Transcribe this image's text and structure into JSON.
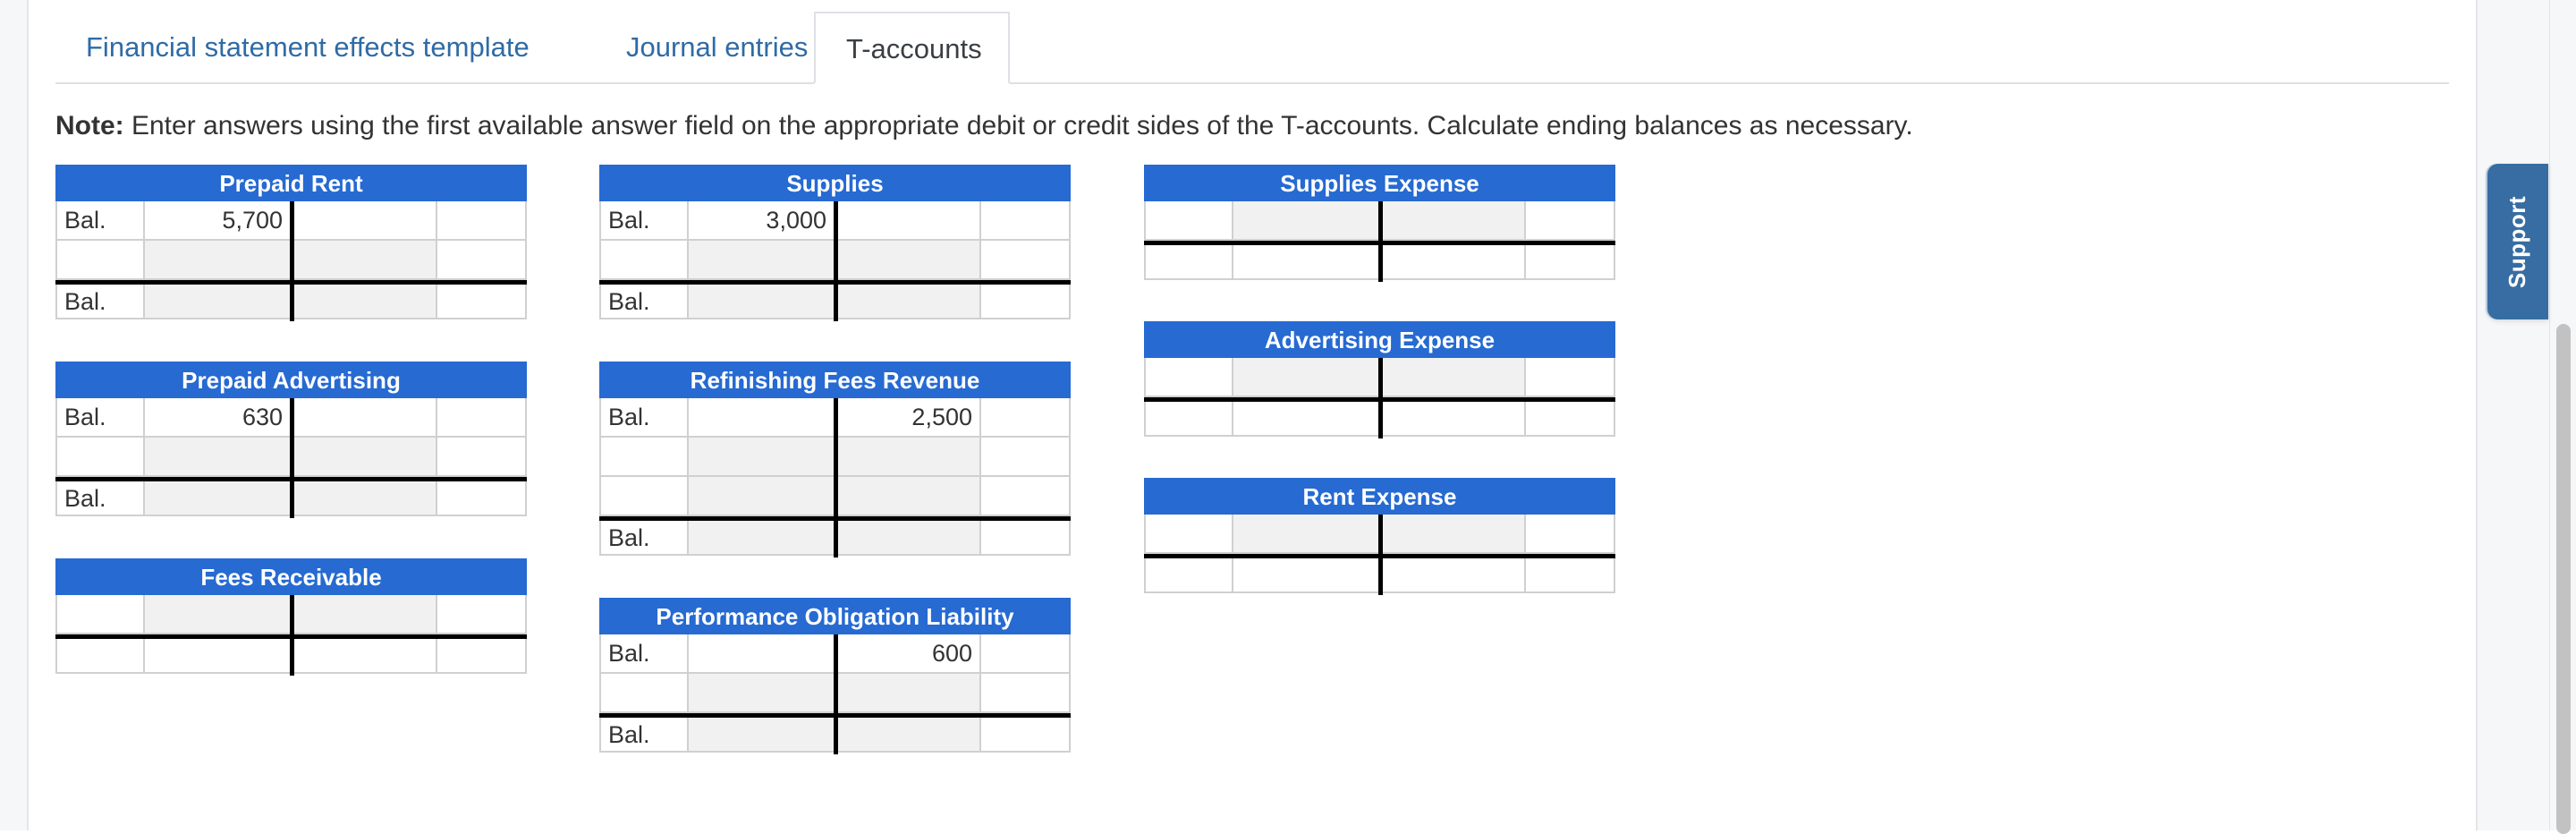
{
  "tabs": [
    {
      "label": "Financial statement effects template",
      "active": false
    },
    {
      "label": "Journal entries",
      "active": false
    },
    {
      "label": "T-accounts",
      "active": true
    }
  ],
  "note": {
    "prefix": "Note:",
    "text": " Enter answers using the first available answer field on the appropriate debit or credit sides of the T-accounts. Calculate ending balances as necessary."
  },
  "support_label": "Support",
  "accounts": {
    "prepaid_rent": {
      "title": "Prepaid Rent",
      "rows": [
        {
          "label": "Bal.",
          "debit": "5,700",
          "credit": ""
        },
        {
          "label": "",
          "debit": "",
          "credit": ""
        },
        {
          "label": "Bal.",
          "debit": "",
          "credit": ""
        }
      ]
    },
    "prepaid_advertising": {
      "title": "Prepaid Advertising",
      "rows": [
        {
          "label": "Bal.",
          "debit": "630",
          "credit": ""
        },
        {
          "label": "",
          "debit": "",
          "credit": ""
        },
        {
          "label": "Bal.",
          "debit": "",
          "credit": ""
        }
      ]
    },
    "fees_receivable": {
      "title": "Fees Receivable",
      "rows": [
        {
          "label": "",
          "debit": "",
          "credit": ""
        },
        {
          "label": "",
          "debit": "",
          "credit": ""
        }
      ]
    },
    "supplies": {
      "title": "Supplies",
      "rows": [
        {
          "label": "Bal.",
          "debit": "3,000",
          "credit": ""
        },
        {
          "label": "",
          "debit": "",
          "credit": ""
        },
        {
          "label": "Bal.",
          "debit": "",
          "credit": ""
        }
      ]
    },
    "refinishing_fees_revenue": {
      "title": "Refinishing Fees Revenue",
      "rows": [
        {
          "label": "Bal.",
          "debit": "",
          "credit": "2,500"
        },
        {
          "label": "",
          "debit": "",
          "credit": ""
        },
        {
          "label": "",
          "debit": "",
          "credit": ""
        },
        {
          "label": "Bal.",
          "debit": "",
          "credit": ""
        }
      ]
    },
    "performance_obligation_liability": {
      "title": "Performance Obligation Liability",
      "rows": [
        {
          "label": "Bal.",
          "debit": "",
          "credit": "600"
        },
        {
          "label": "",
          "debit": "",
          "credit": ""
        },
        {
          "label": "Bal.",
          "debit": "",
          "credit": ""
        }
      ]
    },
    "supplies_expense": {
      "title": "Supplies Expense",
      "rows": [
        {
          "label": "",
          "debit": "",
          "credit": ""
        },
        {
          "label": "",
          "debit": "",
          "credit": ""
        }
      ]
    },
    "advertising_expense": {
      "title": "Advertising Expense",
      "rows": [
        {
          "label": "",
          "debit": "",
          "credit": ""
        },
        {
          "label": "",
          "debit": "",
          "credit": ""
        }
      ]
    },
    "rent_expense": {
      "title": "Rent Expense",
      "rows": [
        {
          "label": "",
          "debit": "",
          "credit": ""
        },
        {
          "label": "",
          "debit": "",
          "credit": ""
        }
      ]
    }
  }
}
